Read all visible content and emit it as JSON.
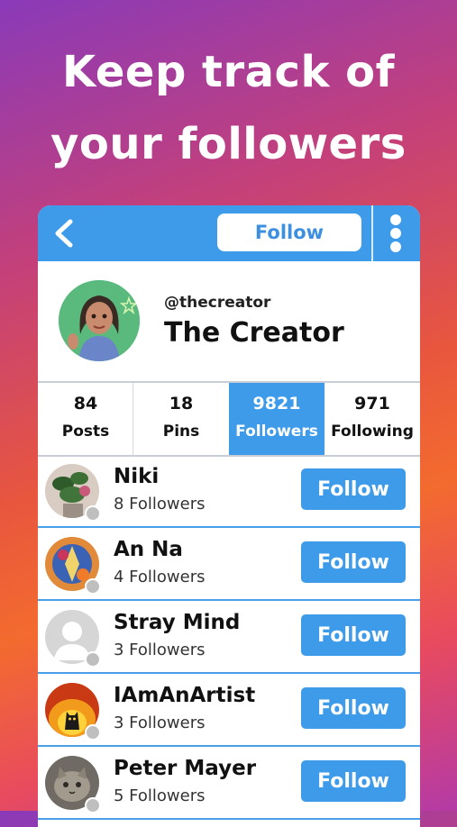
{
  "headline": {
    "line1": "Keep track of",
    "line2": "your followers"
  },
  "topbar": {
    "follow_label": "Follow",
    "back_icon": "chevron-left-icon",
    "more_icon": "vertical-dots-icon"
  },
  "profile": {
    "handle": "@thecreator",
    "name": "The Creator"
  },
  "stats": [
    {
      "value": "84",
      "label": "Posts"
    },
    {
      "value": "18",
      "label": "Pins"
    },
    {
      "value": "9821",
      "label": "Followers"
    },
    {
      "value": "971",
      "label": "Following"
    }
  ],
  "followers": [
    {
      "name": "Niki",
      "count": "8 Followers",
      "button": "Follow"
    },
    {
      "name": "An Na",
      "count": "4 Followers",
      "button": "Follow"
    },
    {
      "name": "Stray Mind",
      "count": "3 Followers",
      "button": "Follow"
    },
    {
      "name": "IAmAnArtist",
      "count": "3 Followers",
      "button": "Follow"
    },
    {
      "name": "Peter Mayer",
      "count": "5 Followers",
      "button": "Follow"
    }
  ],
  "colors": {
    "accent": "#3d9be9",
    "divider": "#4aa0e8"
  }
}
